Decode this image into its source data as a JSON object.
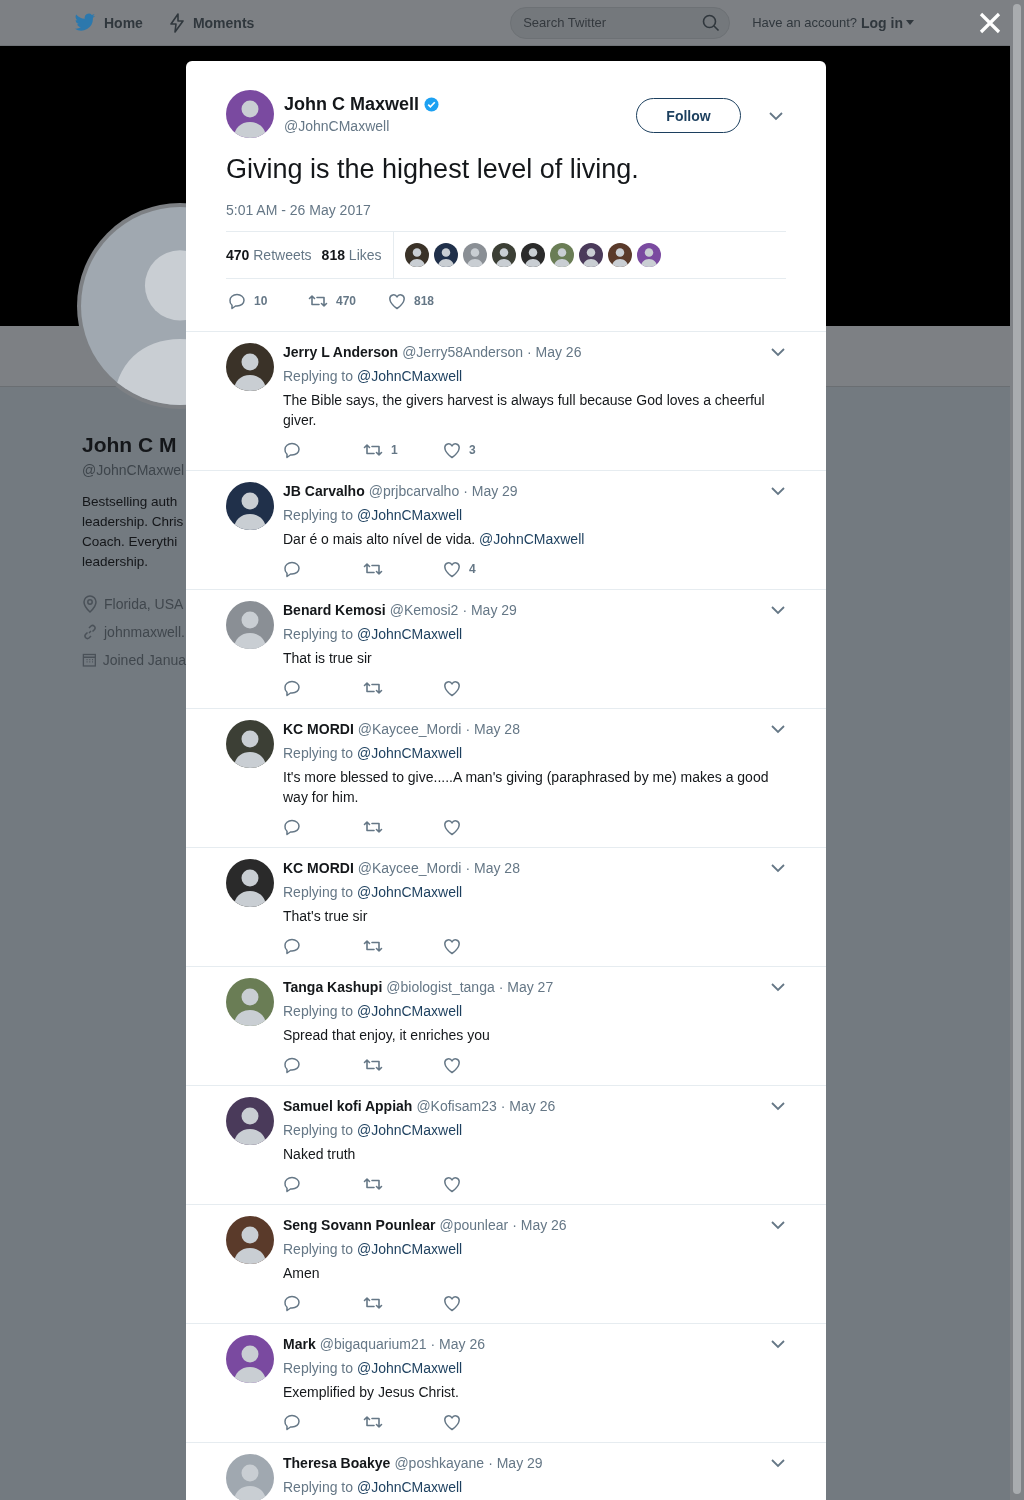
{
  "nav": {
    "links": [
      {
        "label": "Home"
      },
      {
        "label": "Moments"
      }
    ],
    "search": {
      "placeholder": "Search Twitter"
    },
    "account_prompt": "Have an account?",
    "login": "Log in"
  },
  "profile": {
    "name": "John C M",
    "handle": "@JohnCMaxwel",
    "bio_lines": [
      "Bestselling auth",
      "leadership. Chris",
      "Coach. Everythi",
      "leadership."
    ],
    "details": [
      {
        "kind": "location",
        "text": "Florida, USA"
      },
      {
        "kind": "link",
        "text": "johnmaxwell."
      },
      {
        "kind": "joined",
        "text": "Joined Janua"
      }
    ]
  },
  "tweet": {
    "name": "John C Maxwell",
    "verified": true,
    "handle": "@JohnCMaxwell",
    "follow": "Follow",
    "text": "Giving is the highest level of living.",
    "timestamp": "5:01 AM - 26 May 2017",
    "retweets_count": "470",
    "retweets_label": "Retweets",
    "likes_count": "818",
    "likes_label": "Likes",
    "replies": "10",
    "retweets": "470",
    "likes": "818"
  },
  "replies": [
    {
      "name": "Jerry L Anderson",
      "handle": "@Jerry58Anderson",
      "date": "· May 26",
      "replying_label": "Replying to",
      "replying_to": "@JohnCMaxwell",
      "text": "The Bible says, the givers harvest is always full because God loves a cheerful giver.",
      "retweets": "1",
      "likes": "3"
    },
    {
      "name": "JB Carvalho",
      "handle": "@prjbcarvalho",
      "date": "· May 29",
      "replying_label": "Replying to",
      "replying_to": "@JohnCMaxwell",
      "text": "Dar é o mais alto nível de vida.",
      "mention": "@JohnCMaxwell",
      "likes": "4"
    },
    {
      "name": "Benard Kemosi",
      "handle": "@Kemosi2",
      "date": "· May 29",
      "replying_label": "Replying to",
      "replying_to": "@JohnCMaxwell",
      "text": "That is true sir"
    },
    {
      "name": "KC MORDI",
      "handle": "@Kaycee_Mordi",
      "date": "· May 28",
      "replying_label": "Replying to",
      "replying_to": "@JohnCMaxwell",
      "text": "It's more blessed to give.....A man's giving (paraphrased by me) makes a good way for him."
    },
    {
      "name": "KC MORDI",
      "handle": "@Kaycee_Mordi",
      "date": "· May 28",
      "replying_label": "Replying to",
      "replying_to": "@JohnCMaxwell",
      "text": "That's true sir"
    },
    {
      "name": "Tanga Kashupi",
      "handle": "@biologist_tanga",
      "date": "· May 27",
      "replying_label": "Replying to",
      "replying_to": "@JohnCMaxwell",
      "text": "Spread that enjoy,  it enriches you"
    },
    {
      "name": "Samuel kofi Appiah",
      "handle": "@Kofisam23",
      "date": "· May 26",
      "replying_label": "Replying to",
      "replying_to": "@JohnCMaxwell",
      "text": "Naked truth"
    },
    {
      "name": "Seng Sovann Pounlear",
      "handle": "@pounlear",
      "date": "· May 26",
      "replying_label": "Replying to",
      "replying_to": "@JohnCMaxwell",
      "text": "Amen"
    },
    {
      "name": "Mark",
      "handle": "@bigaquarium21",
      "date": "· May 26",
      "replying_label": "Replying to",
      "replying_to": "@JohnCMaxwell",
      "text": "Exemplified by Jesus Christ."
    },
    {
      "name": "Theresa Boakye",
      "handle": "@poshkayane",
      "date": "· May 29",
      "replying_label": "Replying to",
      "replying_to": "@JohnCMaxwell"
    }
  ]
}
